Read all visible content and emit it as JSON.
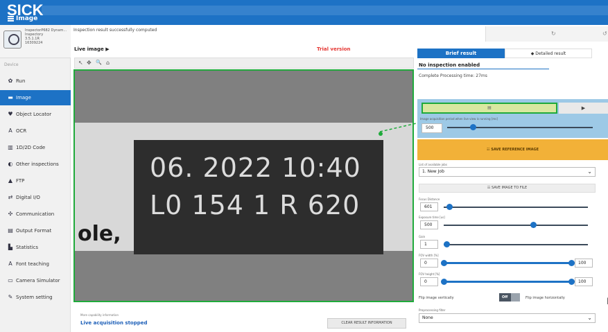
{
  "header": {
    "logo": "SICK",
    "page_title": "Image"
  },
  "device": {
    "lines": [
      "InspectorP682 Dynam...",
      "Inspectory",
      "3.5.1.1R",
      "16309224"
    ]
  },
  "status_message": "Inspection result successfully computed",
  "toolbar_top_right": {
    "refresh": "↻",
    "undo": "↺"
  },
  "sidebar": {
    "section": "Device",
    "items": [
      {
        "label": "Run",
        "icon": "gear-icon",
        "glyph": "✿"
      },
      {
        "label": "Image",
        "icon": "image-icon",
        "glyph": "▬",
        "active": true
      },
      {
        "label": "Object Locator",
        "icon": "location-pin-icon",
        "glyph": "♥"
      },
      {
        "label": "OCR",
        "icon": "ocr-icon",
        "glyph": "A"
      },
      {
        "label": "1D/2D Code",
        "icon": "barcode-icon",
        "glyph": "▥"
      },
      {
        "label": "Other inspections",
        "icon": "inspection-icon",
        "glyph": "◐"
      },
      {
        "label": "FTP",
        "icon": "ftp-icon",
        "glyph": "▲"
      },
      {
        "label": "Digital I/O",
        "icon": "digital-io-icon",
        "glyph": "⇄"
      },
      {
        "label": "Communication",
        "icon": "communication-icon",
        "glyph": "✣"
      },
      {
        "label": "Output Format",
        "icon": "output-format-icon",
        "glyph": "▤"
      },
      {
        "label": "Statistics",
        "icon": "statistics-icon",
        "glyph": "▙"
      },
      {
        "label": "Font teaching",
        "icon": "font-teaching-icon",
        "glyph": "A"
      },
      {
        "label": "Camera Simulator",
        "icon": "monitor-icon",
        "glyph": "▭"
      },
      {
        "label": "System setting",
        "icon": "wrench-icon",
        "glyph": "✎"
      }
    ]
  },
  "live": {
    "title": "Live image ▶",
    "trial": "Trial version",
    "tools": [
      "↖",
      "✥",
      "🔍",
      "⌂"
    ],
    "camera_text": {
      "line1": "06. 2022 10:40",
      "line2": "L0 154 1 R 620",
      "side": "ole,"
    }
  },
  "bottom": {
    "capability_info": "More capability information",
    "acquisition_status": "Live acquisition stopped",
    "clear_button": "CLEAR RESULT INFORMATION"
  },
  "result": {
    "tab_brief": "Brief result",
    "tab_detailed": "◆ Detailed result",
    "no_inspection": "No inspection enabled",
    "processing_time": "Complete Processing time: 27ms"
  },
  "trigger": {
    "button_glyph": "▤",
    "play_glyph": "▶",
    "caption": "Image acquisition period when live view is running [ms]",
    "value": "500",
    "level": 0.12
  },
  "save_reference": "☷ SAVE REFERENCE IMAGE",
  "job": {
    "caption": "List of available jobs",
    "value": "1. New Job"
  },
  "save_file": "☷ SAVE IMAGE TO FILE",
  "sliders": [
    {
      "caption": "Focus Distance",
      "value": "601",
      "level": 0.02
    },
    {
      "caption": "Exposure time [us]",
      "value": "500",
      "level": 0.6
    },
    {
      "caption": "Gain",
      "value": "1",
      "level": 0.0
    },
    {
      "caption": "FOV width [%]",
      "value": "0",
      "max": "100",
      "level": 1.0
    },
    {
      "caption": "FOV height [%]",
      "value": "0",
      "max": "100",
      "level": 1.0
    }
  ],
  "flip": {
    "vertical_label": "Flip image vertically",
    "toggle": "Off",
    "horizontal_label": "Flip image horizontally"
  },
  "preprocessing": {
    "caption": "Preprocessing filter",
    "value": "None"
  },
  "colors": {
    "brand_blue": "#1d72c5",
    "highlight_green": "#1faa3b",
    "save_orange": "#f2b138",
    "trial_red": "#e53935"
  }
}
